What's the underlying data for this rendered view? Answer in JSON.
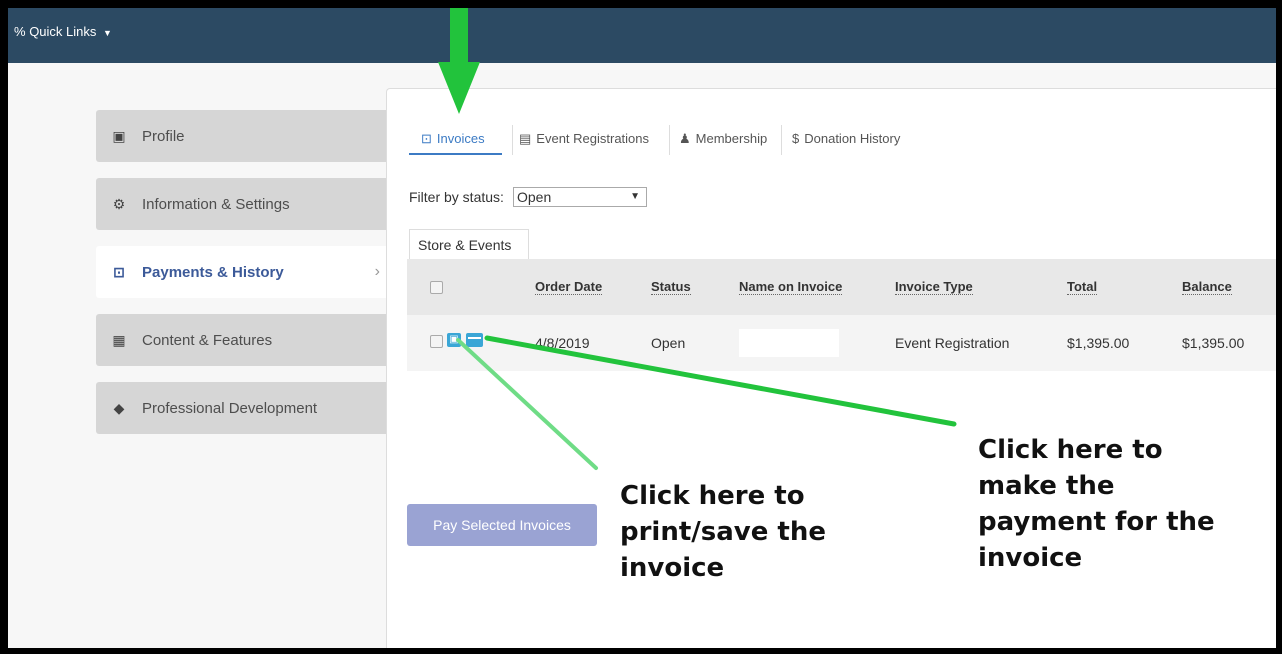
{
  "quick_links": {
    "label": "Quick Links"
  },
  "sidebar": {
    "items": [
      {
        "label": "Profile",
        "icon": "id-badge-icon"
      },
      {
        "label": "Information & Settings",
        "icon": "cogs-icon"
      },
      {
        "label": "Payments & History",
        "icon": "money-icon",
        "active": true
      },
      {
        "label": "Content & Features",
        "icon": "grid-icon"
      },
      {
        "label": "Professional Development",
        "icon": "graduation-cap-icon"
      }
    ]
  },
  "tabs": [
    {
      "label": "Invoices",
      "icon": "money-icon",
      "active": true
    },
    {
      "label": "Event Registrations",
      "icon": "calendar-icon"
    },
    {
      "label": "Membership",
      "icon": "user-icon"
    },
    {
      "label": "Donation History",
      "icon": "dollar-icon"
    }
  ],
  "filter": {
    "label": "Filter by status:",
    "value": "Open"
  },
  "subtab": {
    "label": "Store & Events"
  },
  "table": {
    "columns": [
      "Order Date",
      "Status",
      "Name on Invoice",
      "Invoice Type",
      "Total",
      "Balance"
    ],
    "rows": [
      {
        "order_date": "4/8/2019",
        "status": "Open",
        "name_on_invoice": "",
        "invoice_type": "Event Registration",
        "total": "$1,395.00",
        "balance": "$1,395.00"
      }
    ]
  },
  "pay_button": {
    "label": "Pay Selected Invoices"
  },
  "annotations": {
    "print": [
      "Click here to",
      "print/save the",
      "invoice"
    ],
    "pay": [
      "Click here to",
      "make the",
      "payment for the",
      "invoice"
    ]
  },
  "colors": {
    "topbar": "#2c4a63",
    "accent": "#3c7bc4",
    "arrow": "#22c33c",
    "pay_button": "#9aa3d3"
  }
}
